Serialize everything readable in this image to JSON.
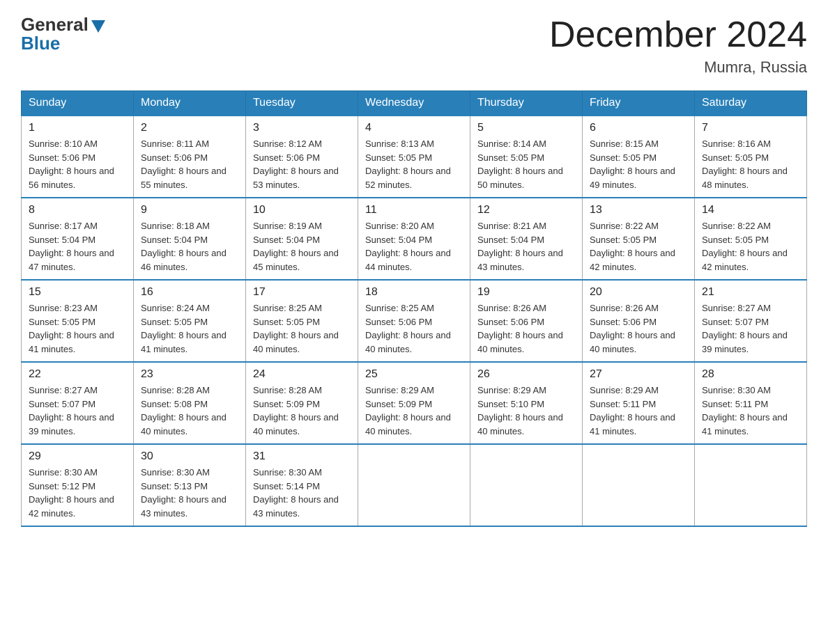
{
  "header": {
    "logo_general": "General",
    "logo_blue": "Blue",
    "month_title": "December 2024",
    "location": "Mumra, Russia"
  },
  "days_of_week": [
    "Sunday",
    "Monday",
    "Tuesday",
    "Wednesday",
    "Thursday",
    "Friday",
    "Saturday"
  ],
  "weeks": [
    [
      {
        "day": "1",
        "sunrise": "8:10 AM",
        "sunset": "5:06 PM",
        "daylight": "8 hours and 56 minutes."
      },
      {
        "day": "2",
        "sunrise": "8:11 AM",
        "sunset": "5:06 PM",
        "daylight": "8 hours and 55 minutes."
      },
      {
        "day": "3",
        "sunrise": "8:12 AM",
        "sunset": "5:06 PM",
        "daylight": "8 hours and 53 minutes."
      },
      {
        "day": "4",
        "sunrise": "8:13 AM",
        "sunset": "5:05 PM",
        "daylight": "8 hours and 52 minutes."
      },
      {
        "day": "5",
        "sunrise": "8:14 AM",
        "sunset": "5:05 PM",
        "daylight": "8 hours and 50 minutes."
      },
      {
        "day": "6",
        "sunrise": "8:15 AM",
        "sunset": "5:05 PM",
        "daylight": "8 hours and 49 minutes."
      },
      {
        "day": "7",
        "sunrise": "8:16 AM",
        "sunset": "5:05 PM",
        "daylight": "8 hours and 48 minutes."
      }
    ],
    [
      {
        "day": "8",
        "sunrise": "8:17 AM",
        "sunset": "5:04 PM",
        "daylight": "8 hours and 47 minutes."
      },
      {
        "day": "9",
        "sunrise": "8:18 AM",
        "sunset": "5:04 PM",
        "daylight": "8 hours and 46 minutes."
      },
      {
        "day": "10",
        "sunrise": "8:19 AM",
        "sunset": "5:04 PM",
        "daylight": "8 hours and 45 minutes."
      },
      {
        "day": "11",
        "sunrise": "8:20 AM",
        "sunset": "5:04 PM",
        "daylight": "8 hours and 44 minutes."
      },
      {
        "day": "12",
        "sunrise": "8:21 AM",
        "sunset": "5:04 PM",
        "daylight": "8 hours and 43 minutes."
      },
      {
        "day": "13",
        "sunrise": "8:22 AM",
        "sunset": "5:05 PM",
        "daylight": "8 hours and 42 minutes."
      },
      {
        "day": "14",
        "sunrise": "8:22 AM",
        "sunset": "5:05 PM",
        "daylight": "8 hours and 42 minutes."
      }
    ],
    [
      {
        "day": "15",
        "sunrise": "8:23 AM",
        "sunset": "5:05 PM",
        "daylight": "8 hours and 41 minutes."
      },
      {
        "day": "16",
        "sunrise": "8:24 AM",
        "sunset": "5:05 PM",
        "daylight": "8 hours and 41 minutes."
      },
      {
        "day": "17",
        "sunrise": "8:25 AM",
        "sunset": "5:05 PM",
        "daylight": "8 hours and 40 minutes."
      },
      {
        "day": "18",
        "sunrise": "8:25 AM",
        "sunset": "5:06 PM",
        "daylight": "8 hours and 40 minutes."
      },
      {
        "day": "19",
        "sunrise": "8:26 AM",
        "sunset": "5:06 PM",
        "daylight": "8 hours and 40 minutes."
      },
      {
        "day": "20",
        "sunrise": "8:26 AM",
        "sunset": "5:06 PM",
        "daylight": "8 hours and 40 minutes."
      },
      {
        "day": "21",
        "sunrise": "8:27 AM",
        "sunset": "5:07 PM",
        "daylight": "8 hours and 39 minutes."
      }
    ],
    [
      {
        "day": "22",
        "sunrise": "8:27 AM",
        "sunset": "5:07 PM",
        "daylight": "8 hours and 39 minutes."
      },
      {
        "day": "23",
        "sunrise": "8:28 AM",
        "sunset": "5:08 PM",
        "daylight": "8 hours and 40 minutes."
      },
      {
        "day": "24",
        "sunrise": "8:28 AM",
        "sunset": "5:09 PM",
        "daylight": "8 hours and 40 minutes."
      },
      {
        "day": "25",
        "sunrise": "8:29 AM",
        "sunset": "5:09 PM",
        "daylight": "8 hours and 40 minutes."
      },
      {
        "day": "26",
        "sunrise": "8:29 AM",
        "sunset": "5:10 PM",
        "daylight": "8 hours and 40 minutes."
      },
      {
        "day": "27",
        "sunrise": "8:29 AM",
        "sunset": "5:11 PM",
        "daylight": "8 hours and 41 minutes."
      },
      {
        "day": "28",
        "sunrise": "8:30 AM",
        "sunset": "5:11 PM",
        "daylight": "8 hours and 41 minutes."
      }
    ],
    [
      {
        "day": "29",
        "sunrise": "8:30 AM",
        "sunset": "5:12 PM",
        "daylight": "8 hours and 42 minutes."
      },
      {
        "day": "30",
        "sunrise": "8:30 AM",
        "sunset": "5:13 PM",
        "daylight": "8 hours and 43 minutes."
      },
      {
        "day": "31",
        "sunrise": "8:30 AM",
        "sunset": "5:14 PM",
        "daylight": "8 hours and 43 minutes."
      },
      null,
      null,
      null,
      null
    ]
  ]
}
